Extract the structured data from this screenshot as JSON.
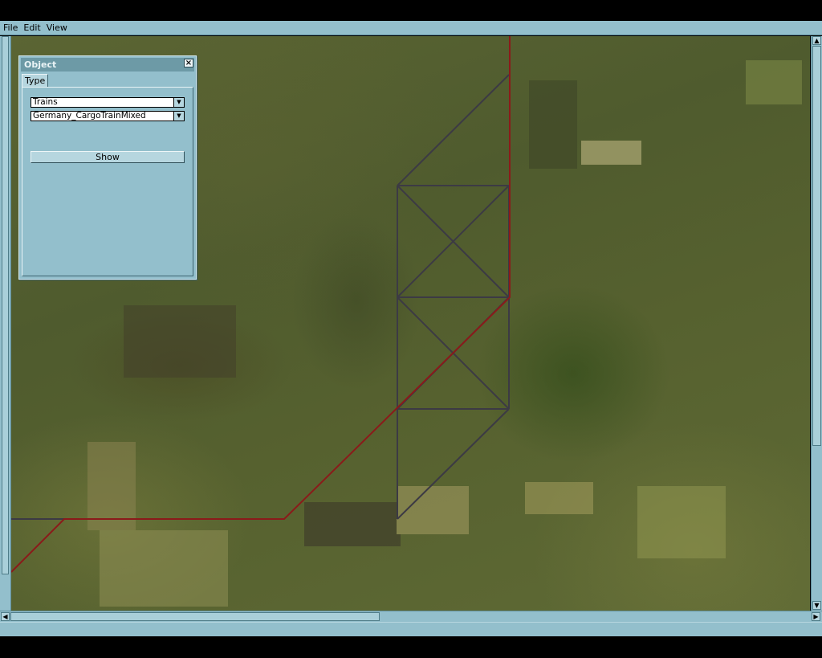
{
  "menu": {
    "file": "File",
    "edit": "Edit",
    "view": "View"
  },
  "object_panel": {
    "title": "Object",
    "close_glyph": "×",
    "tab_type": "Type",
    "category_value": "Trains",
    "object_value": "Germany_CargoTrainMixed",
    "show_button": "Show"
  },
  "scrollbars": {
    "up_arrow": "▲",
    "down_arrow": "▼",
    "left_arrow": "◀",
    "right_arrow": "▶"
  },
  "colors": {
    "ui_background": "#93bfcc",
    "panel_title": "#6d9aa6",
    "rail_line": "#8b1a1a",
    "grid_line": "#3c3a44"
  },
  "icons": {
    "close": "close-icon",
    "dropdown": "chevron-down-icon"
  }
}
